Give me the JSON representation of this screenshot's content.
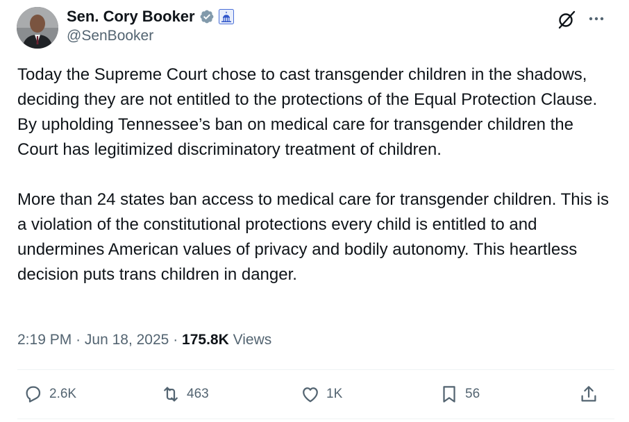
{
  "author": {
    "display_name": "Sen. Cory Booker",
    "handle": "@SenBooker"
  },
  "icons": {
    "verified": "verified-badge-icon",
    "government": "government-capitol-badge-icon",
    "grok": "grok-icon",
    "more": "more-options-icon",
    "reply": "reply-icon",
    "repost": "repost-icon",
    "like": "like-icon",
    "bookmark": "bookmark-icon",
    "share": "share-icon"
  },
  "tweet": {
    "paragraphs": [
      "Today the Supreme Court chose to cast transgender children in the shadows, deciding they are not entitled to the protections of the Equal Protection Clause. By upholding Tennessee’s ban on medical care for transgender children the Court has legitimized discriminatory treatment of children.",
      "More than 24 states ban access to medical care for transgender children. This is a violation of the constitutional protections every child is entitled to and undermines American values of privacy and bodily autonomy. This heartless decision puts trans children in danger."
    ],
    "time": "2:19 PM",
    "separator": "·",
    "date": "Jun 18, 2025",
    "views_count": "175.8K",
    "views_label": "Views"
  },
  "actions": {
    "reply_count": "2.6K",
    "repost_count": "463",
    "like_count": "1K",
    "bookmark_count": "56"
  },
  "colors": {
    "text_primary": "#0f1419",
    "text_secondary": "#536471",
    "verified_badge": "#829aab",
    "divider": "#eff3f4"
  }
}
